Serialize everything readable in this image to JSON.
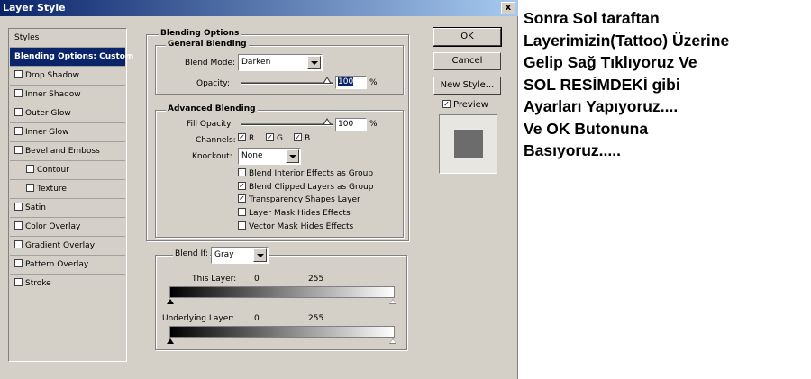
{
  "window": {
    "title": "Layer Style",
    "close_symbol": "x"
  },
  "styles_list": {
    "header": "Styles",
    "items": [
      {
        "label": "Blending Options: Custom",
        "selected": true,
        "checkbox": false,
        "sub": false
      },
      {
        "label": "Drop Shadow",
        "checkbox": true,
        "sub": false
      },
      {
        "label": "Inner Shadow",
        "checkbox": true,
        "sub": false
      },
      {
        "label": "Outer Glow",
        "checkbox": true,
        "sub": false
      },
      {
        "label": "Inner Glow",
        "checkbox": true,
        "sub": false
      },
      {
        "label": "Bevel and Emboss",
        "checkbox": true,
        "sub": false
      },
      {
        "label": "Contour",
        "checkbox": true,
        "sub": true
      },
      {
        "label": "Texture",
        "checkbox": true,
        "sub": true
      },
      {
        "label": "Satin",
        "checkbox": true,
        "sub": false
      },
      {
        "label": "Color Overlay",
        "checkbox": true,
        "sub": false
      },
      {
        "label": "Gradient Overlay",
        "checkbox": true,
        "sub": false
      },
      {
        "label": "Pattern Overlay",
        "checkbox": true,
        "sub": false
      },
      {
        "label": "Stroke",
        "checkbox": true,
        "sub": false
      }
    ]
  },
  "blending": {
    "title": "Blending Options",
    "general": {
      "title": "General Blending",
      "blend_mode_label": "Blend Mode:",
      "blend_mode_value": "Darken",
      "opacity_label": "Opacity:",
      "opacity_value": "100",
      "percent": "%"
    },
    "advanced": {
      "title": "Advanced Blending",
      "fill_opacity_label": "Fill Opacity:",
      "fill_opacity_value": "100",
      "percent": "%",
      "channels_label": "Channels:",
      "channels": [
        "R",
        "G",
        "B"
      ],
      "knockout_label": "Knockout:",
      "knockout_value": "None",
      "options": [
        {
          "label": "Blend Interior Effects as Group",
          "checked": false
        },
        {
          "label": "Blend Clipped Layers as Group",
          "checked": true
        },
        {
          "label": "Transparency Shapes Layer",
          "checked": true
        },
        {
          "label": "Layer Mask Hides Effects",
          "checked": false
        },
        {
          "label": "Vector Mask Hides Effects",
          "checked": false
        }
      ]
    },
    "blend_if": {
      "label": "Blend If:",
      "value": "Gray",
      "this_layer_label": "This Layer:",
      "underlying_label": "Underlying Layer:",
      "min": "0",
      "max": "255"
    }
  },
  "buttons": {
    "ok": "OK",
    "cancel": "Cancel",
    "new_style": "New Style...",
    "preview_label": "Preview",
    "check_mark": "✓"
  },
  "annotation": {
    "text": "Sonra Sol taraftan\nLayerimizin(Tattoo) Üzerine\nGelip Sağ Tıklıyoruz Ve\nSOL RESİMDEKİ gibi\nAyarları Yapıyoruz....\nVe OK Butonuna\nBasıyoruz....."
  }
}
